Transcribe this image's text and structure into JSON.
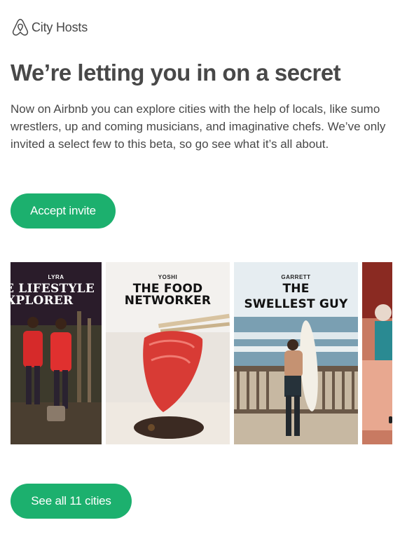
{
  "header": {
    "logo_icon": "airbnb-belo-icon",
    "brand": "City Hosts"
  },
  "headline": "We’re letting you in on a secret",
  "body": "Now on Airbnb you can explore cities with the help of locals, like sumo wrestlers, up and coming musicians, and imaginative chefs. We’ve only invited a select few to this beta, so go see what it’s all about.",
  "accept_button": "Accept invite",
  "carousel": {
    "cards": [
      {
        "name": "LYRA",
        "title_line1": "E LIFESTYLE",
        "title_line2": "XPLORER"
      },
      {
        "name": "YOSHI",
        "title_line1": "THE FOOD",
        "title_line2": "NETWORKER"
      },
      {
        "name": "GARRETT",
        "title_line1": "THE",
        "title_line2": "SWELLEST GUY"
      }
    ]
  },
  "cities_button": "See all 11 cities",
  "colors": {
    "accent_green": "#1cb06e",
    "text": "#484848"
  }
}
